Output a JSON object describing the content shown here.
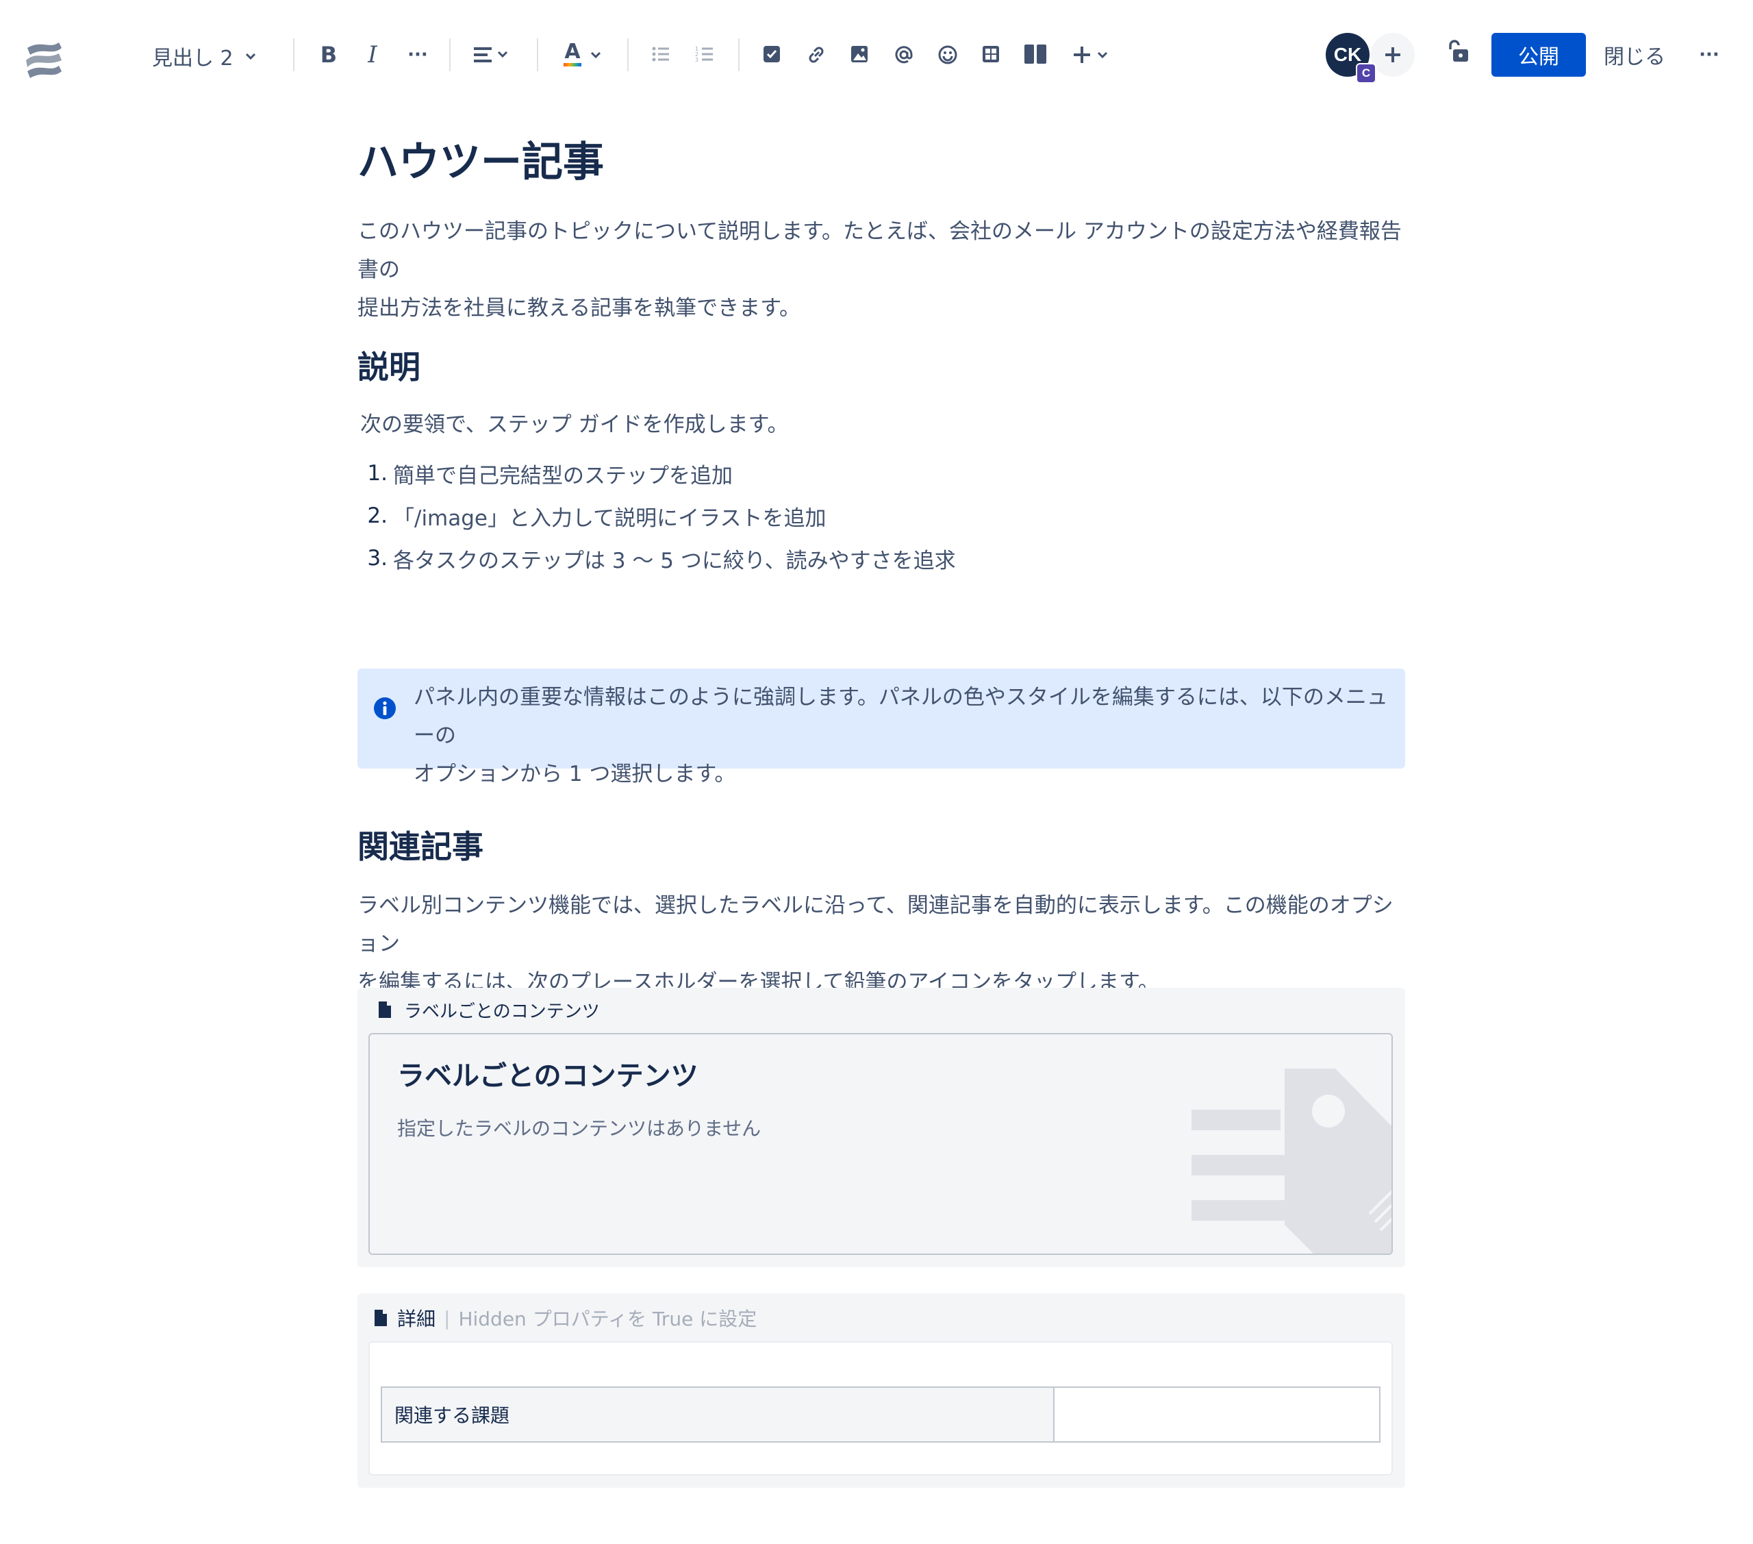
{
  "toolbar": {
    "logo_icon": "confluence-logo-icon",
    "text_style": "見出し 2",
    "bold_label": "B",
    "italic_label": "I",
    "more_label": "···",
    "text_color_label": "A",
    "icons": [
      "bullet-list-icon",
      "numbered-list-icon",
      "action-item-icon",
      "link-icon",
      "image-icon",
      "mention-icon",
      "emoji-icon",
      "table-icon",
      "layout-icon",
      "insert-plus-icon"
    ],
    "avatar_initials": "CK",
    "avatar_badge": "C",
    "publish_label": "公開",
    "close_label": "閉じる",
    "overflow_label": "···",
    "colors": {
      "primary": "#0052CC",
      "avatar": "#172B4D",
      "badge": "#5243AA"
    }
  },
  "page": {
    "title": "ハウツー記事",
    "intro_line1": "このハウツー記事のトピックについて説明します。たとえば、会社のメール アカウントの設定方法や経費報告書の",
    "intro_line2": "提出方法を社員に教える記事を執筆できます。",
    "section1": {
      "heading": "説明",
      "lead": "次の要領で、ステップ ガイドを作成します。",
      "steps": [
        {
          "num": "1.",
          "text": "簡単で自己完結型のステップを追加"
        },
        {
          "num": "2.",
          "text": "「/image」と入力して説明にイラストを追加"
        },
        {
          "num": "3.",
          "text": "各タスクのステップは 3 ～ 5 つに絞り、読みやすさを追求"
        }
      ]
    },
    "info_panel": {
      "icon": "info-icon",
      "line1": "パネル内の重要な情報はこのように強調します。パネルの色やスタイルを編集するには、以下のメニューの",
      "line2": "オプションから 1 つ選択します。",
      "color": "#DEEBFF"
    },
    "section2": {
      "heading": "関連記事",
      "line1": "ラベル別コンテンツ機能では、選択したラベルに沿って、関連記事を自動的に表示します。この機能のオプション",
      "line2": "を編集するには、次のプレースホルダーを選択して鉛筆のアイコンをタップします。"
    },
    "labels_macro": {
      "header": "ラベルごとのコンテンツ",
      "title": "ラベルごとのコンテンツ",
      "empty": "指定したラベルのコンテンツはありません"
    },
    "details_macro": {
      "label": "詳細",
      "separator": "|",
      "hint": "Hidden プロパティを True に設定",
      "row_header": "関連する課題",
      "row_value": ""
    }
  }
}
